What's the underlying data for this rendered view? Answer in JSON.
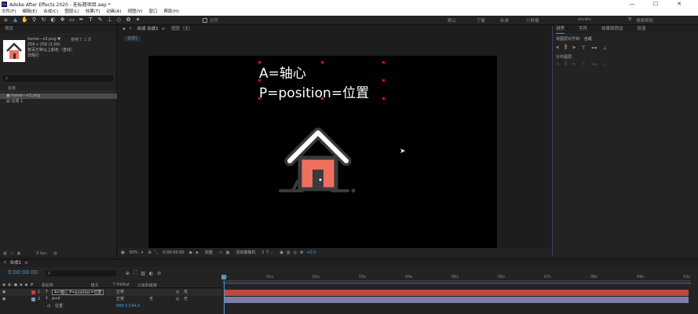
{
  "title_bar": {
    "title": "Adobe After Effects 2020 - 无标题项目.aep *",
    "minimize": "—",
    "maximize": "☐",
    "close": "✕"
  },
  "menu": [
    "文件(F)",
    "编辑(E)",
    "合成(C)",
    "图层(L)",
    "效果(T)",
    "动画(A)",
    "视图(V)",
    "窗口",
    "帮助(H)"
  ],
  "toolbar": {
    "snap_label": "对齐",
    "workspaces": [
      "默认",
      "了解",
      "标准",
      "小屏幕"
    ],
    "studio": "studio",
    "search_placeholder": "搜索帮助"
  },
  "project_panel": {
    "tab": "项目",
    "asset_name": "home---v3.png ▼",
    "asset_used": "使用了 1 次",
    "asset_size": "256 x 256 (1.00)",
    "asset_desc1": "数百万种以上颜色（直线）",
    "asset_desc2": "非隔行",
    "search_placeholder": "ρ",
    "col_name": "名称",
    "items": [
      {
        "name": "home---v3.png",
        "icon": "image-icon"
      },
      {
        "name": "合成 1",
        "icon": "composition-icon"
      }
    ],
    "footer_bpc": "8 bpc"
  },
  "viewer": {
    "tab_comp": "合成 合成1",
    "tab_layer": "图层（无）",
    "comp_label": "合成1",
    "overlay_line1": "A=轴心",
    "overlay_line2": "P=position=位置",
    "zoom": "50%",
    "timecode": "0:00:00:00",
    "quality": "完整",
    "camera": "活动摄像机",
    "views": "1 个…",
    "exposure": "+0.0"
  },
  "right_panel": {
    "tabs": [
      "对齐",
      "字符",
      "效果和预设",
      "段落"
    ],
    "align_layers_to": "将图层对齐到:",
    "align_target": "合成",
    "distribute_label": "分布图层:"
  },
  "timeline": {
    "tab": "合成1",
    "timecode": "0:00:00:00",
    "search_placeholder": "ρ",
    "col_source": "源名称",
    "col_mode": "模式",
    "col_trkmat": "T TrkMat",
    "col_parent": "父级和链接",
    "layers": [
      {
        "num": "1",
        "name": "A=轴心 P=position=位置",
        "mode": "正常",
        "trkmat": "",
        "parent": "无",
        "color": "#c94040"
      },
      {
        "num": "2",
        "name": "A=P",
        "mode": "正常",
        "trkmat": "无",
        "parent": "无",
        "color": "#8a8ac7"
      }
    ],
    "sub_property": "位置",
    "sub_value": "888.0,544.0",
    "ruler": [
      "0s",
      "01s",
      "02s",
      "03s",
      "04s",
      "05s",
      "06s",
      "07s",
      "08s",
      "09s",
      "10s"
    ]
  },
  "colors": {
    "accent": "#2d8ceb",
    "layer1": "#c94040",
    "layer2": "#8a8ac7",
    "house_body": "#f07060",
    "house_roof": "#ffffff",
    "house_outline": "#3a3a3a"
  }
}
